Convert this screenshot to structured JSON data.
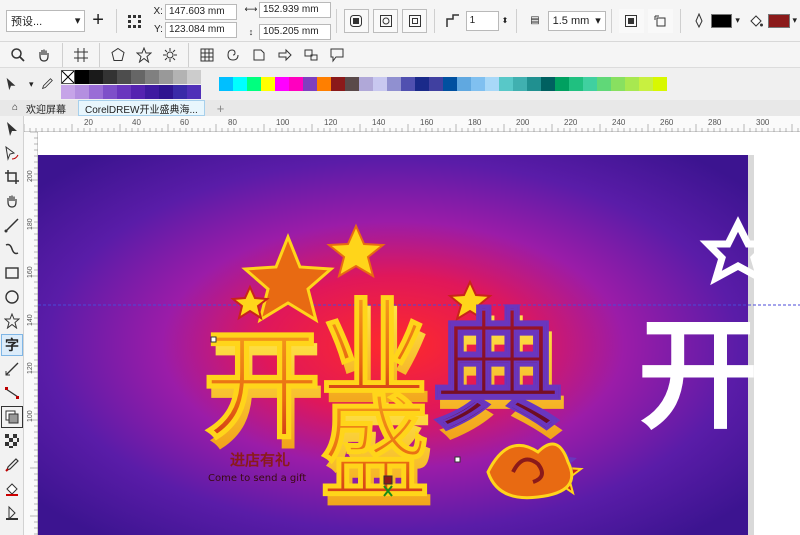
{
  "property_bar": {
    "preset": "预设...",
    "x_label": "X:",
    "x_value": "147.603 mm",
    "y_label": "Y:",
    "y_value": "123.084 mm",
    "width_value": "152.939 mm",
    "height_value": "105.205 mm",
    "corner_count": "1",
    "outline_width": "1.5 mm",
    "fill_color": "#000000",
    "outline_color": "#8b1a1a"
  },
  "tabs": {
    "welcome": "欢迎屏幕",
    "document": "CorelDREW开业盛典海..."
  },
  "palette": {
    "grays": [
      "#000000",
      "#1a1a1a",
      "#333333",
      "#4d4d4d",
      "#666666",
      "#808080",
      "#999999",
      "#b3b3b3",
      "#cccccc",
      "#e6e6e6"
    ],
    "purples": [
      "#c6a4e8",
      "#b48fe0",
      "#9a6dd6",
      "#7e4fc9",
      "#6a36be",
      "#5523b0",
      "#3f1aa0",
      "#2e1490",
      "#3a2aa8",
      "#5030b8"
    ],
    "colors": [
      "#00bfff",
      "#00ffff",
      "#00ff7f",
      "#ffff00",
      "#ff00ff",
      "#ff00bf",
      "#7f3fbf",
      "#ff7f00",
      "#8b1a1a",
      "#5a4a4a",
      "#b0a8d8",
      "#c8c8f0",
      "#9090d0",
      "#5050b0",
      "#1a2a8a",
      "#4040a0",
      "#0050a0",
      "#60a8e0",
      "#80c0f0",
      "#a8d8f8",
      "#58c8c8",
      "#40b0b0",
      "#209090",
      "#006060",
      "#00a060",
      "#20c080",
      "#40d0a0",
      "#60d878",
      "#88e060",
      "#a8e850",
      "#c8f040",
      "#d8f800"
    ]
  },
  "rulers": {
    "h_ticks": [
      "20",
      "40",
      "60",
      "80",
      "100",
      "120",
      "140",
      "160",
      "180",
      "200",
      "220",
      "240",
      "260",
      "280",
      "300"
    ],
    "v_ticks": [
      "200",
      "180",
      "160",
      "140",
      "120",
      "100"
    ]
  },
  "artwork": {
    "headline_chars": [
      "开",
      "盛",
      "典"
    ],
    "top_char": "业",
    "tagline_cn": "进店有礼",
    "tagline_en": "Come to send a gift",
    "clone_char": "开"
  },
  "colors": {
    "bg_purple": "#4a1a9a",
    "accent_orange": "#f39a1a",
    "accent_yellow": "#ffd51a"
  }
}
